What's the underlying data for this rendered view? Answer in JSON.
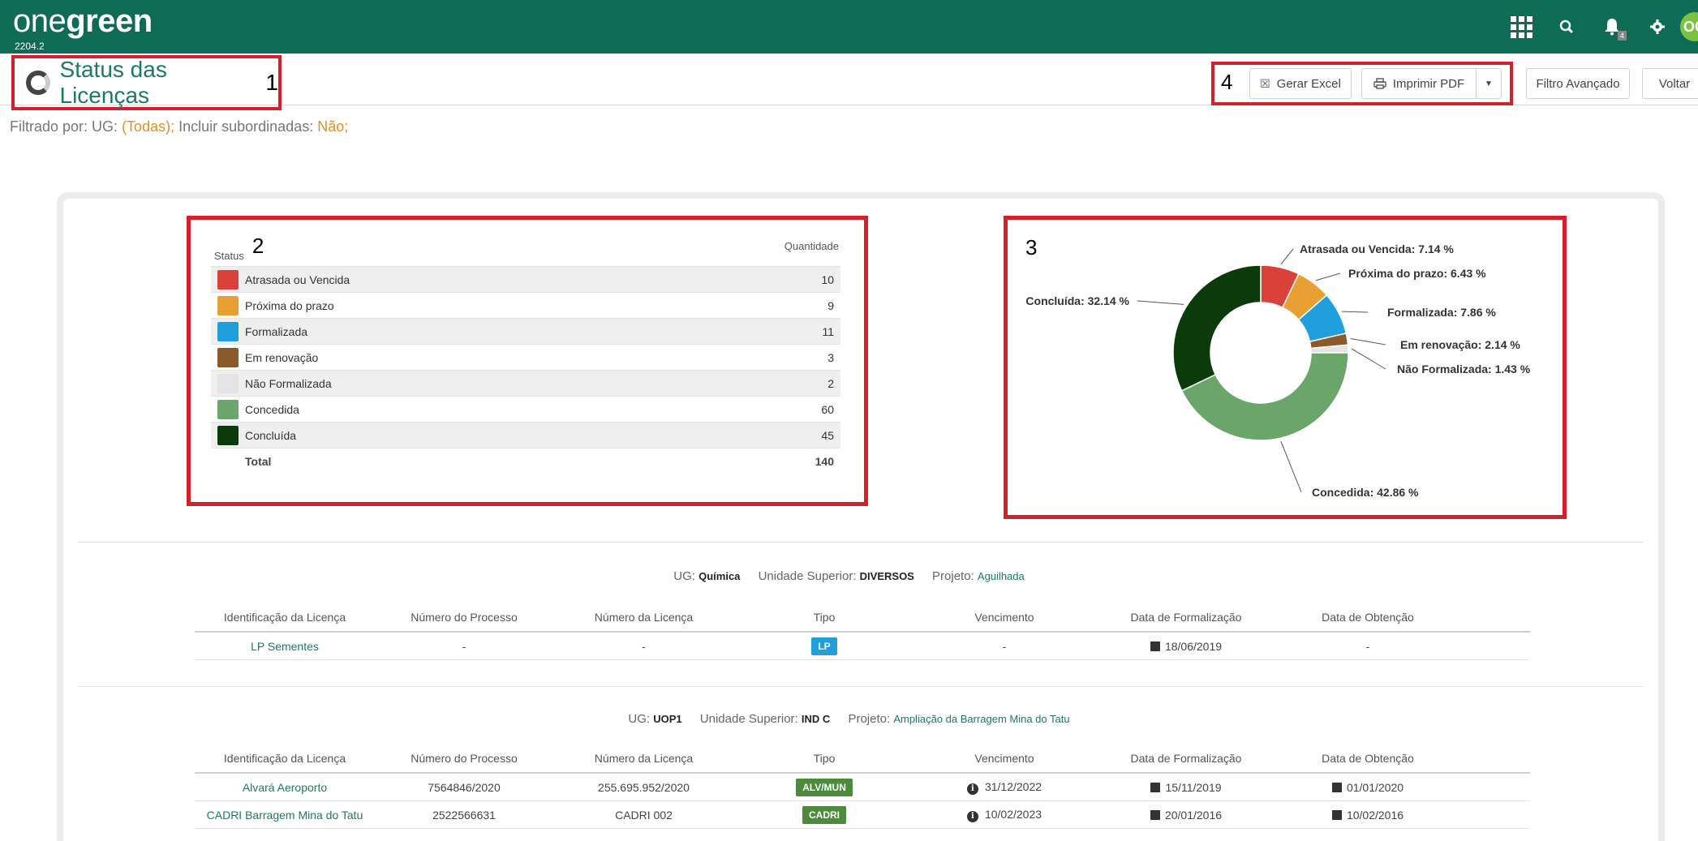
{
  "app": {
    "logo_light": "one",
    "logo_bold": "green",
    "version": "2204.2",
    "avatar": "OG",
    "notification_count": "4"
  },
  "page": {
    "title": "Status das Licenças",
    "annotation": "1"
  },
  "toolbar": {
    "annotation": "4",
    "excel": "Gerar Excel",
    "pdf": "Imprimir PDF",
    "filter": "Filtro Avançado",
    "back": "Voltar"
  },
  "filter": {
    "prefix": "Filtrado por: UG:",
    "ug_value": "(Todas);",
    "sub_label": "Incluir subordinadas:",
    "sub_value": "Não;"
  },
  "status_table": {
    "annotation": "2",
    "header_status": "Status",
    "header_qty": "Quantidade",
    "rows": [
      {
        "label": "Atrasada ou Vencida",
        "qty": "10",
        "color": "#d9413a"
      },
      {
        "label": "Próxima do prazo",
        "qty": "9",
        "color": "#e9a032"
      },
      {
        "label": "Formalizada",
        "qty": "11",
        "color": "#1fa0dc"
      },
      {
        "label": "Em renovação",
        "qty": "3",
        "color": "#8b5a2b"
      },
      {
        "label": "Não Formalizada",
        "qty": "2",
        "color": "#e4e4e4"
      },
      {
        "label": "Concedida",
        "qty": "60",
        "color": "#6aa56a"
      },
      {
        "label": "Concluída",
        "qty": "45",
        "color": "#0b3a0b"
      }
    ],
    "total_label": "Total",
    "total_value": "140"
  },
  "chart_data": {
    "type": "pie",
    "annotation": "3",
    "categories": [
      "Atrasada ou Vencida",
      "Próxima do prazo",
      "Formalizada",
      "Em renovação",
      "Não Formalizada",
      "Concedida",
      "Concluída"
    ],
    "values": [
      7.14,
      6.43,
      7.86,
      2.14,
      1.43,
      42.86,
      32.14
    ],
    "colors": [
      "#d9413a",
      "#e9a032",
      "#1fa0dc",
      "#8b5a2b",
      "#e4e4e4",
      "#6aa56a",
      "#0b3a0b"
    ],
    "labels": [
      "Atrasada ou Vencida: 7.14 %",
      "Próxima do prazo: 6.43 %",
      "Formalizada: 7.86 %",
      "Em renovação: 2.14 %",
      "Não Formalizada: 1.43 %",
      "Concedida: 42.86 %",
      "Concluída: 32.14 %"
    ],
    "donut": true
  },
  "table_headers": [
    "Identificação da Licença",
    "Número do Processo",
    "Número da Licença",
    "Tipo",
    "Vencimento",
    "Data de Formalização",
    "Data de Obtenção"
  ],
  "sections": [
    {
      "ug_label": "UG:",
      "ug": "Química",
      "sup_label": "Unidade Superior:",
      "sup": "DIVERSOS",
      "proj_label": "Projeto:",
      "proj": "Aguilhada",
      "rows": [
        {
          "id": "LP Sementes",
          "processo": "-",
          "licenca": "-",
          "tipo": "LP",
          "tipo_color": "#1fa0dc",
          "venc": "-",
          "venc_info": false,
          "form": "18/06/2019",
          "obt": "-"
        }
      ]
    },
    {
      "ug_label": "UG:",
      "ug": "UOP1",
      "sup_label": "Unidade Superior:",
      "sup": "IND C",
      "proj_label": "Projeto:",
      "proj": "Ampliação da Barragem Mina do Tatu",
      "rows": [
        {
          "id": "Alvará Aeroporto",
          "processo": "7564846/2020",
          "licenca": "255.695.952/2020",
          "tipo": "ALV/MUN",
          "tipo_color": "#4b8b3b",
          "venc": "31/12/2022",
          "venc_info": true,
          "form": "15/11/2019",
          "obt": "01/01/2020"
        },
        {
          "id": "CADRI Barragem Mina do Tatu",
          "processo": "2522566631",
          "licenca": "CADRI 002",
          "tipo": "CADRI",
          "tipo_color": "#4b8b3b",
          "venc": "10/02/2023",
          "venc_info": true,
          "form": "20/01/2016",
          "obt": "10/02/2016"
        }
      ]
    }
  ]
}
